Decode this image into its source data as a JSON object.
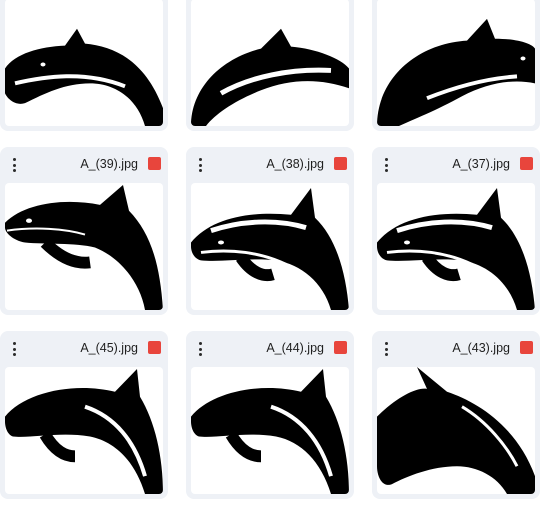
{
  "grid": {
    "columns": 3,
    "cards": [
      {
        "filename": "",
        "icon": "image-icon",
        "menu_icon": "more-vert-icon"
      },
      {
        "filename": "",
        "icon": "image-icon",
        "menu_icon": "more-vert-icon"
      },
      {
        "filename": "",
        "icon": "image-icon",
        "menu_icon": "more-vert-icon"
      },
      {
        "filename": "A_(39).jpg",
        "icon": "image-icon",
        "menu_icon": "more-vert-icon"
      },
      {
        "filename": "A_(38).jpg",
        "icon": "image-icon",
        "menu_icon": "more-vert-icon"
      },
      {
        "filename": "A_(37).jpg",
        "icon": "image-icon",
        "menu_icon": "more-vert-icon"
      },
      {
        "filename": "A_(45).jpg",
        "icon": "image-icon",
        "menu_icon": "more-vert-icon"
      },
      {
        "filename": "A_(44).jpg",
        "icon": "image-icon",
        "menu_icon": "more-vert-icon"
      },
      {
        "filename": "A_(43).jpg",
        "icon": "image-icon",
        "menu_icon": "more-vert-icon"
      }
    ]
  },
  "colors": {
    "card_bg": "#eef1f6",
    "image_icon": "#e8453c",
    "silhouette": "#000000"
  }
}
